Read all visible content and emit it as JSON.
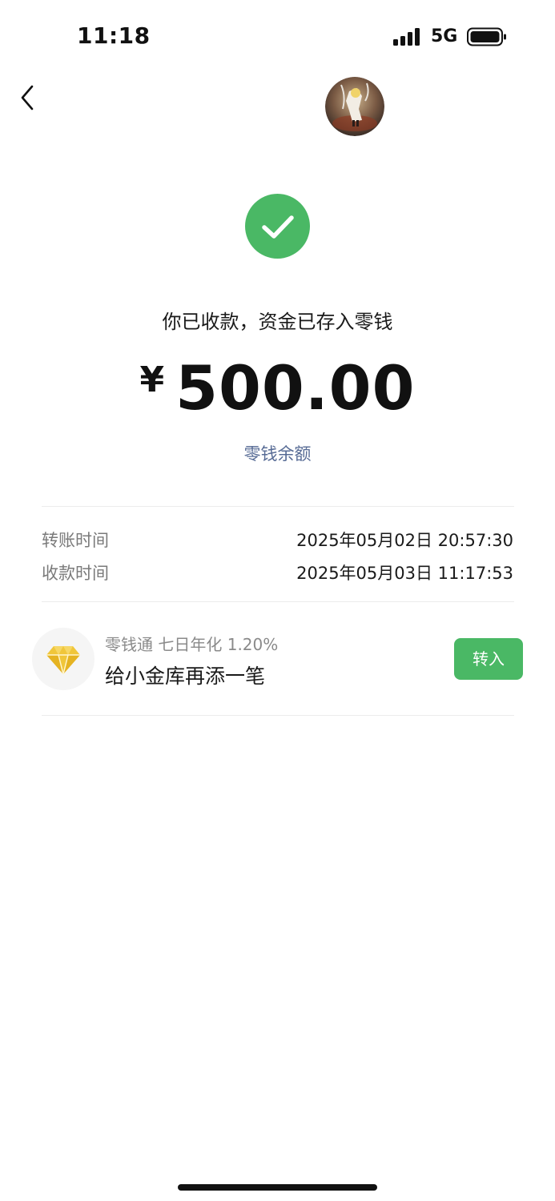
{
  "status_bar": {
    "time": "11:18",
    "network": "5G",
    "icons": [
      "signal-icon",
      "battery-icon"
    ]
  },
  "nav": {
    "icons": [
      "back-icon",
      "avatar"
    ]
  },
  "result": {
    "icon": "check-icon",
    "accent_color": "#4ab865",
    "message": "你已收款，资金已存入零钱",
    "currency": "¥",
    "amount": "500.00",
    "balance_link": "零钱余额",
    "link_color": "#576b95"
  },
  "details": [
    {
      "label": "转账时间",
      "value": "2025年05月02日 20:57:30"
    },
    {
      "label": "收款时间",
      "value": "2025年05月03日 11:17:53"
    }
  ],
  "promo": {
    "icon": "diamond-icon",
    "subtitle": "零钱通 七日年化 1.20%",
    "title": "给小金库再添一笔",
    "button_label": "转入"
  }
}
